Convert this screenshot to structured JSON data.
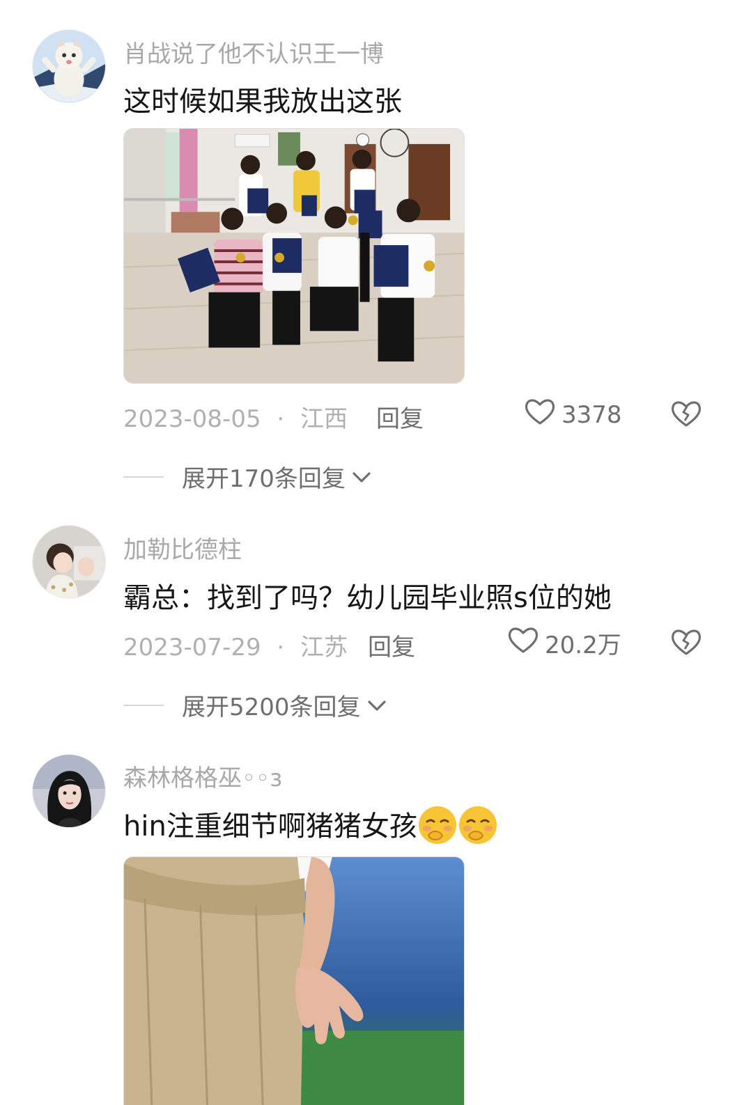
{
  "comments": [
    {
      "username": "肖战说了他不认识王一博",
      "text": "这时候如果我放出这张",
      "date": "2023-08-05",
      "location": "江西",
      "separator": "·",
      "reply_label": "回复",
      "likes": "3378",
      "expand_label": "展开170条回复"
    },
    {
      "username": "加勒比德柱",
      "text": "霸总：找到了吗？幼儿园毕业照s位的她",
      "date": "2023-07-29",
      "location": "江苏",
      "separator": "·",
      "reply_label": "回复",
      "likes": "20.2万",
      "expand_label": "展开5200条回复"
    },
    {
      "username": "森林格格巫◦◦ɜ",
      "text": "hin注重细节啊猪猪女孩",
      "emoji": "shy-smile-emoji"
    }
  ],
  "icons": {
    "like": "heart-icon",
    "dislike": "broken-heart-icon",
    "expand": "chevron-down-icon"
  },
  "colors": {
    "username": "#a8a8a8",
    "body": "#161616",
    "meta": "#b0b0b0",
    "action": "#6e6e6e"
  }
}
